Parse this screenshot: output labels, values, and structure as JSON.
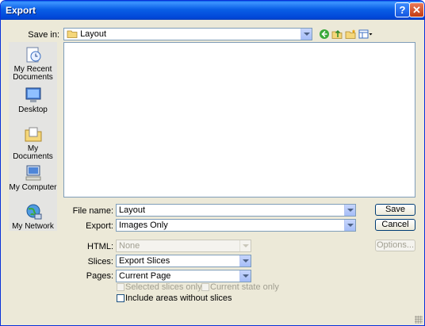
{
  "window": {
    "title": "Export"
  },
  "save_in": {
    "label": "Save in:",
    "value": "Layout"
  },
  "places": [
    {
      "label": "My Recent Documents",
      "icon": "recent-documents-icon"
    },
    {
      "label": "Desktop",
      "icon": "desktop-icon"
    },
    {
      "label": "My Documents",
      "icon": "my-documents-icon"
    },
    {
      "label": "My Computer",
      "icon": "my-computer-icon"
    },
    {
      "label": "My Network",
      "icon": "my-network-icon"
    }
  ],
  "file_name": {
    "label": "File name:",
    "value": "Layout"
  },
  "export": {
    "label": "Export:",
    "value": "Images Only"
  },
  "html": {
    "label": "HTML:",
    "value": "None"
  },
  "slices": {
    "label": "Slices:",
    "value": "Export Slices"
  },
  "pages": {
    "label": "Pages:",
    "value": "Current Page"
  },
  "checkboxes": {
    "selected_slices": "Selected slices only",
    "current_state": "Current state only",
    "include_areas": "Include areas without slices"
  },
  "buttons": {
    "save": "Save",
    "cancel": "Cancel",
    "options": "Options..."
  }
}
